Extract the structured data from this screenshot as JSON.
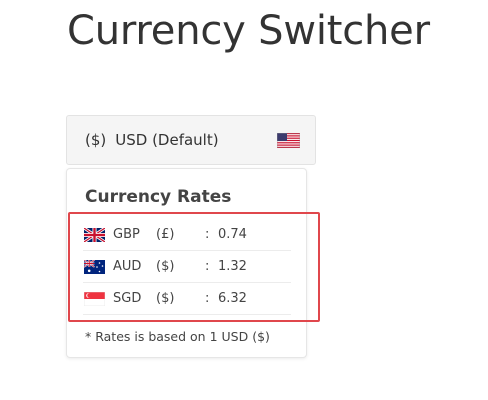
{
  "page": {
    "title": "Currency Switcher"
  },
  "switcher": {
    "symbol": "($)",
    "label": "USD (Default)",
    "flag_icon": "us-flag-icon"
  },
  "rates": {
    "title": "Currency Rates",
    "rows": [
      {
        "flag_icon": "uk-flag-icon",
        "code": "GBP",
        "symbol": "(£)",
        "separator": ":",
        "value": "0.74"
      },
      {
        "flag_icon": "australia-flag-icon",
        "code": "AUD",
        "symbol": "($)",
        "separator": ":",
        "value": "1.32"
      },
      {
        "flag_icon": "singapore-flag-icon",
        "code": "SGD",
        "symbol": "($)",
        "separator": ":",
        "value": "6.32"
      }
    ],
    "note": "* Rates is based on 1 USD ($)"
  },
  "colors": {
    "highlight": "#e0474c",
    "switcher_bg": "#f5f5f5",
    "text": "#444444"
  }
}
